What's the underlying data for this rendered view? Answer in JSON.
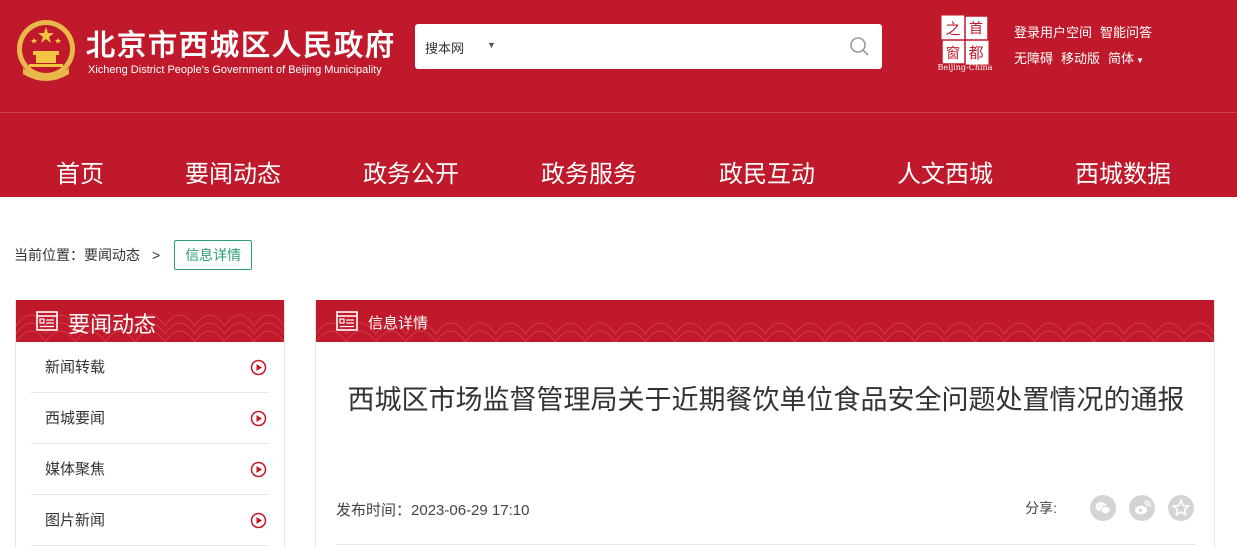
{
  "header": {
    "title": "北京市西城区人民政府",
    "subtitle": "Xicheng District People's Government of Beijing Municipality",
    "capital_logo": {
      "chars": [
        "之",
        "首",
        "窗",
        "都"
      ],
      "caption": "Beijing-China"
    },
    "links_row1": [
      "登录用户空间",
      "智能问答"
    ],
    "links_row2": [
      "无障碍",
      "移动版",
      "简体"
    ]
  },
  "search": {
    "scope": "搜本网",
    "placeholder": "",
    "icon": "search-icon"
  },
  "nav": {
    "items": [
      "首页",
      "要闻动态",
      "政务公开",
      "政务服务",
      "政民互动",
      "人文西城",
      "西城数据"
    ]
  },
  "breadcrumb": {
    "prefix": "当前位置：",
    "section": "要闻动态",
    "separator": ">",
    "current": "信息详情"
  },
  "sidebar": {
    "title": "要闻动态",
    "icon": "document-list-icon",
    "items": [
      {
        "label": "新闻转载"
      },
      {
        "label": "西城要闻"
      },
      {
        "label": "媒体聚焦"
      },
      {
        "label": "图片新闻"
      }
    ]
  },
  "article": {
    "panel_title": "信息详情",
    "title": "西城区市场监督管理局关于近期餐饮单位食品安全问题处置情况的通报",
    "publish_label": "发布时间：",
    "publish_time": "2023-06-29 17:10",
    "share_label": "分享:",
    "share_icons": [
      "wechat-icon",
      "weibo-icon",
      "favorite-star-icon"
    ]
  },
  "colors": {
    "brand_red": "#c0192b",
    "accent_green": "#2c9e7a",
    "arrow_red": "#c0192b"
  }
}
